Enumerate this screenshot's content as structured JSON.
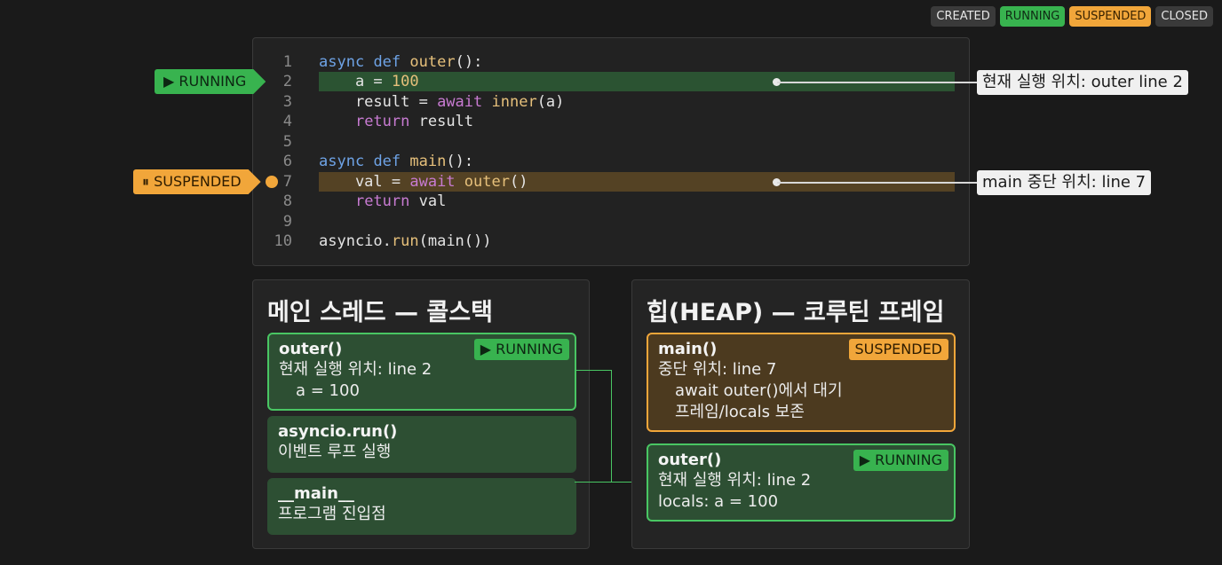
{
  "legend": {
    "created": "CREATED",
    "running": "RUNNING",
    "suspended": "SUSPENDED",
    "closed": "CLOSED"
  },
  "code": {
    "lines": [
      {
        "n": "1"
      },
      {
        "n": "2"
      },
      {
        "n": "3"
      },
      {
        "n": "4"
      },
      {
        "n": "5"
      },
      {
        "n": "6"
      },
      {
        "n": "7"
      },
      {
        "n": "8"
      },
      {
        "n": "9"
      },
      {
        "n": "10"
      }
    ]
  },
  "tags": {
    "running": "RUNNING",
    "suspended": "SUSPENDED"
  },
  "callouts": {
    "outer": "현재 실행 위치: outer line 2",
    "main": "main 중단 위치: line 7"
  },
  "stack_panel": {
    "title": "메인 스레드 — 콜스택",
    "frames": [
      {
        "name": "outer()",
        "badge": "RUNNING",
        "lines": [
          "현재 실행 위치: line 2",
          "a = 100"
        ]
      },
      {
        "name": "asyncio.run()",
        "lines": [
          "이벤트 루프 실행"
        ]
      },
      {
        "name": "__main__",
        "lines": [
          "프로그램 진입점"
        ]
      }
    ]
  },
  "heap_panel": {
    "title": "힙(HEAP) — 코루틴 프레임",
    "frames": [
      {
        "name": "main()",
        "badge": "SUSPENDED",
        "lines": [
          "중단 위치: line 7",
          "await outer()에서 대기",
          "프레임/locals 보존"
        ]
      },
      {
        "name": "outer()",
        "badge": "RUNNING",
        "lines": [
          "현재 실행 위치: line 2",
          "locals: a = 100"
        ]
      }
    ]
  },
  "colors": {
    "running": "#38b34f",
    "suspended": "#f1a63a",
    "neutral": "#3a3a3a"
  }
}
